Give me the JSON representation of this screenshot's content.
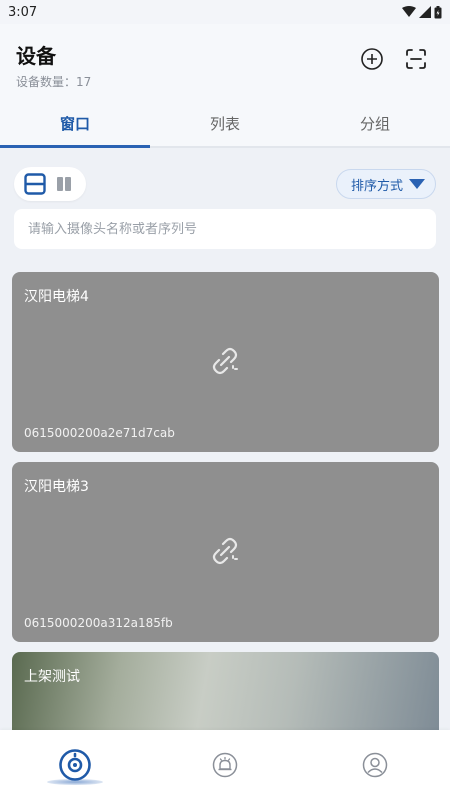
{
  "status_bar": {
    "time": "3:07"
  },
  "header": {
    "title": "设备",
    "device_count_label": "设备数量：17"
  },
  "tabs": [
    {
      "label": "窗口",
      "active": true
    },
    {
      "label": "列表",
      "active": false
    },
    {
      "label": "分组",
      "active": false
    }
  ],
  "toolbar": {
    "sort_label": "排序方式"
  },
  "search": {
    "placeholder": "请输入摄像头名称或者序列号",
    "value": ""
  },
  "devices": [
    {
      "name": "汉阳电梯4",
      "serial": "0615000200a2e71d7cab",
      "status": "offline"
    },
    {
      "name": "汉阳电梯3",
      "serial": "0615000200a312a185fb",
      "status": "offline"
    },
    {
      "name": "上架测试",
      "serial": "",
      "status": "online"
    }
  ],
  "bottom_nav": [
    {
      "icon": "camera-icon",
      "active": true
    },
    {
      "icon": "alarm-icon",
      "active": false
    },
    {
      "icon": "profile-icon",
      "active": false
    }
  ],
  "colors": {
    "accent": "#2a62b3",
    "accent_dark": "#1f5aa8",
    "card_offline": "#8f8f8f",
    "page_bg": "#eef1f6"
  }
}
